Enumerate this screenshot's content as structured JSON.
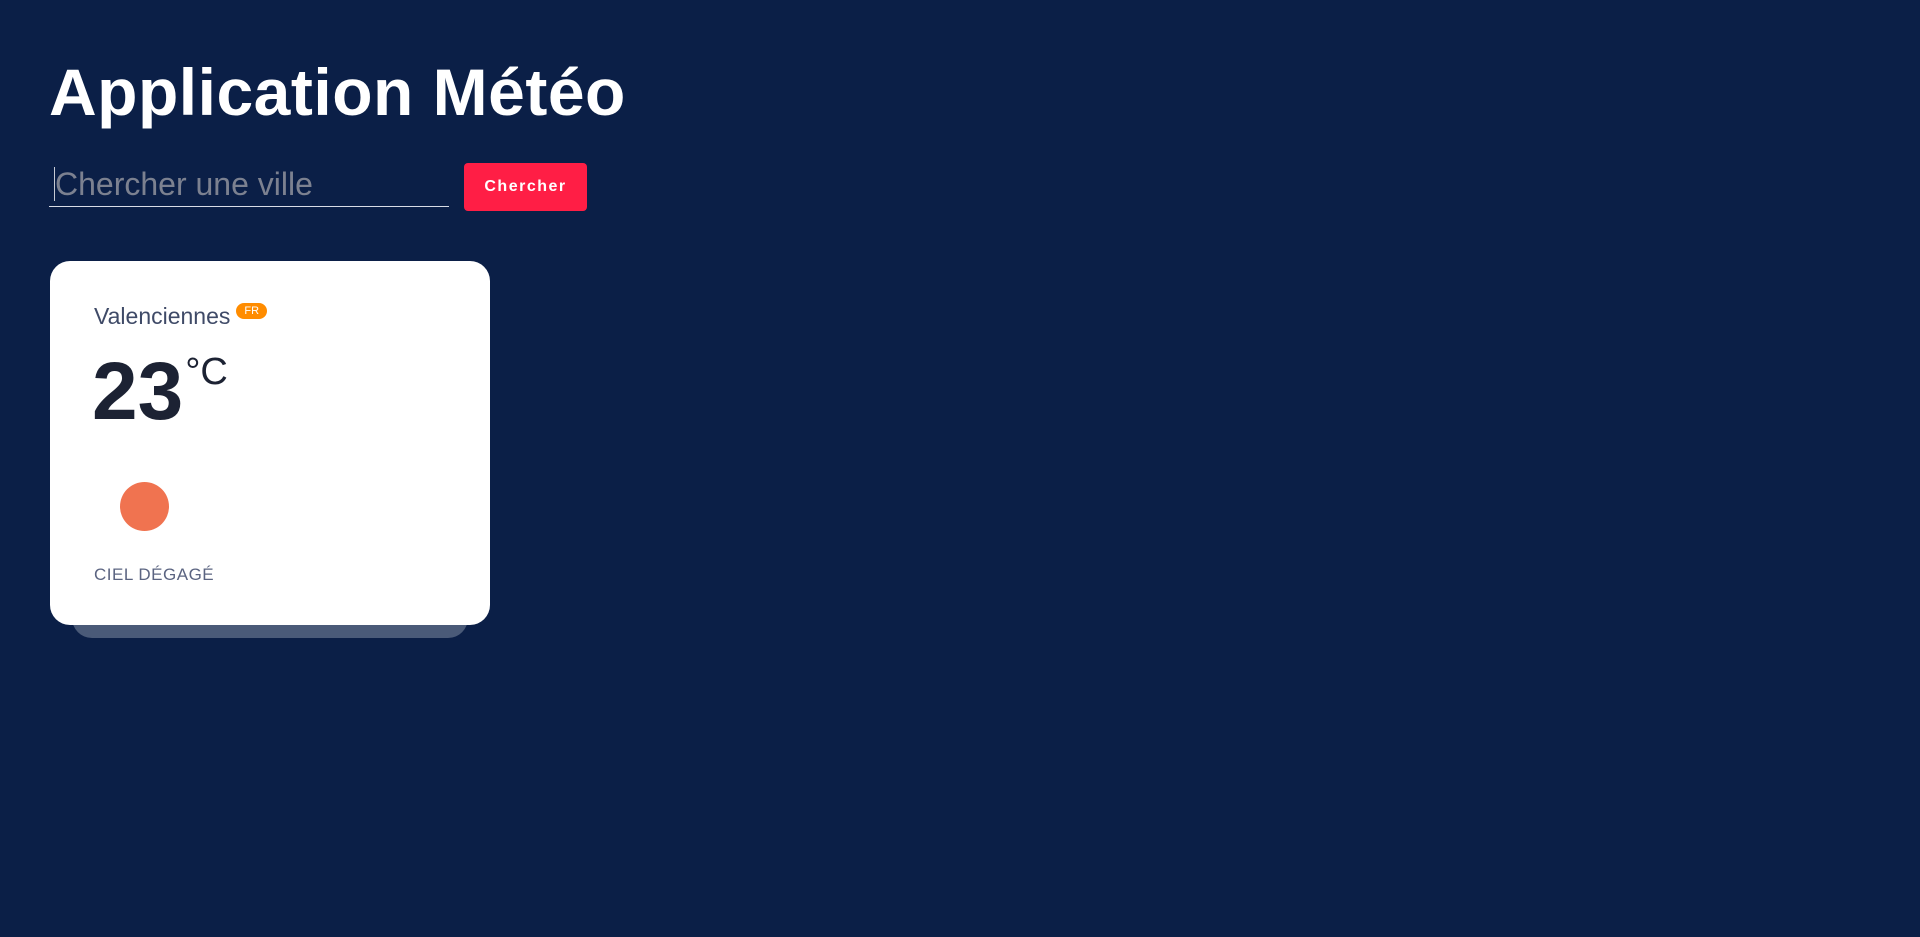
{
  "app": {
    "title": "Application Météo"
  },
  "search": {
    "placeholder": "Chercher une ville",
    "value": "",
    "button_label": "Chercher"
  },
  "weather_card": {
    "city": "Valenciennes",
    "country_code": "FR",
    "temperature": "23",
    "unit": "°C",
    "icon": "clear-sky-sun-icon",
    "description": "CIEL DÉGAGÉ"
  },
  "colors": {
    "background": "#0b1f47",
    "button": "#ff1e45",
    "badge": "#ff8c00",
    "sun_icon": "#f07350",
    "card_background": "#ffffff"
  }
}
